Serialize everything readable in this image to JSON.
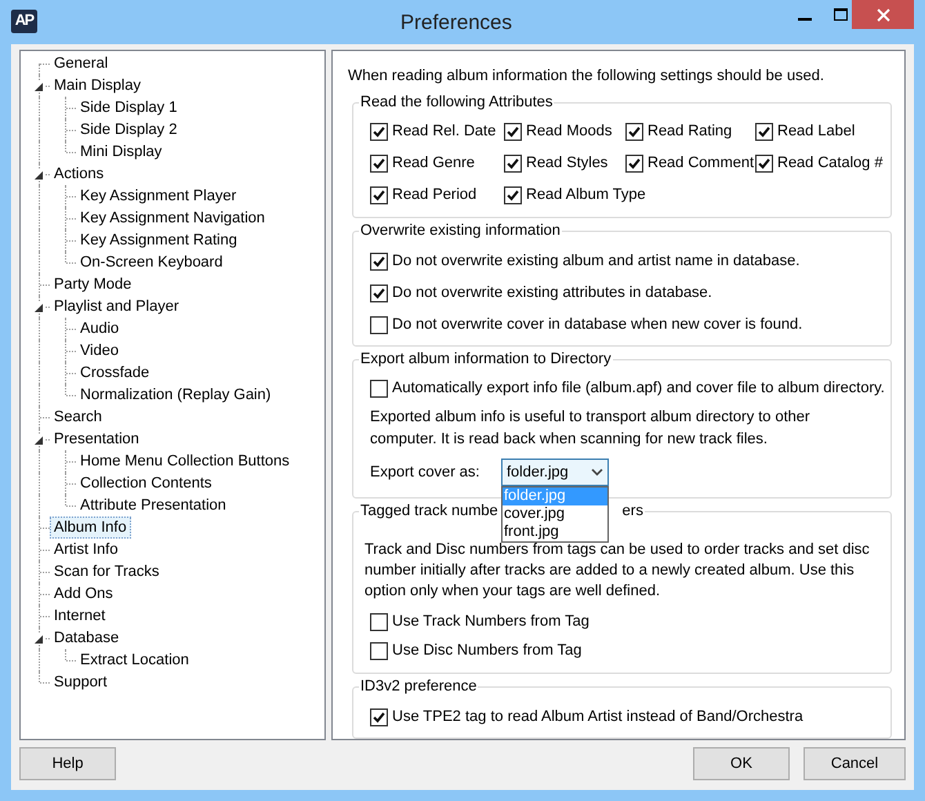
{
  "window": {
    "title": "Preferences",
    "logo": "AP"
  },
  "tree": [
    {
      "label": "General",
      "selected": false
    },
    {
      "label": "Main Display",
      "selected": false,
      "expanded": true,
      "children": [
        {
          "label": "Side Display 1",
          "selected": false
        },
        {
          "label": "Side Display 2",
          "selected": false
        },
        {
          "label": "Mini Display",
          "selected": false
        }
      ]
    },
    {
      "label": "Actions",
      "selected": false,
      "expanded": true,
      "children": [
        {
          "label": "Key Assignment Player",
          "selected": false
        },
        {
          "label": "Key Assignment Navigation",
          "selected": false
        },
        {
          "label": "Key Assignment Rating",
          "selected": false
        },
        {
          "label": "On-Screen Keyboard",
          "selected": false
        }
      ]
    },
    {
      "label": "Party Mode",
      "selected": false
    },
    {
      "label": "Playlist and Player",
      "selected": false,
      "expanded": true,
      "children": [
        {
          "label": "Audio",
          "selected": false
        },
        {
          "label": "Video",
          "selected": false
        },
        {
          "label": "Crossfade",
          "selected": false
        },
        {
          "label": "Normalization (Replay Gain)",
          "selected": false
        }
      ]
    },
    {
      "label": "Search",
      "selected": false
    },
    {
      "label": "Presentation",
      "selected": false,
      "expanded": true,
      "children": [
        {
          "label": "Home Menu Collection Buttons",
          "selected": false
        },
        {
          "label": "Collection Contents",
          "selected": false
        },
        {
          "label": "Attribute Presentation",
          "selected": false
        }
      ]
    },
    {
      "label": "Album Info",
      "selected": true
    },
    {
      "label": "Artist Info",
      "selected": false
    },
    {
      "label": "Scan for Tracks",
      "selected": false
    },
    {
      "label": "Add Ons",
      "selected": false
    },
    {
      "label": "Internet",
      "selected": false
    },
    {
      "label": "Database",
      "selected": false,
      "expanded": true,
      "children": [
        {
          "label": "Extract Location",
          "selected": false
        }
      ]
    },
    {
      "label": "Support",
      "selected": false
    }
  ],
  "intro": "When reading album information the following settings should be used.",
  "groups": [
    {
      "kind": "grid",
      "title": "Read the following Attributes",
      "items": [
        {
          "label": "Read Rel. Date",
          "checked": true
        },
        {
          "label": "Read Moods",
          "checked": true
        },
        {
          "label": "Read Rating",
          "checked": true
        },
        {
          "label": "Read Label",
          "checked": true
        },
        {
          "label": "Read Genre",
          "checked": true
        },
        {
          "label": "Read Styles",
          "checked": true
        },
        {
          "label": "Read Comment",
          "checked": true
        },
        {
          "label": "Read Catalog #",
          "checked": true
        },
        {
          "label": "Read Period",
          "checked": true
        },
        {
          "label": "Read Album Type",
          "checked": true
        }
      ]
    },
    {
      "kind": "list",
      "title": "Overwrite existing information",
      "items": [
        {
          "label": "Do not overwrite existing album and artist name in database.",
          "checked": true
        },
        {
          "label": "Do not overwrite existing attributes in database.",
          "checked": true
        },
        {
          "label": "Do not overwrite cover in database when new cover is found.",
          "checked": false
        }
      ]
    },
    {
      "kind": "export",
      "title": "Export album information to Directory",
      "items": [
        {
          "label": "Automatically export info file (album.apf) and cover file to album directory.",
          "checked": false
        }
      ],
      "text": "Exported album info is useful to transport album directory to other computer. It is read back when scanning for new track files.",
      "select_label": "Export cover as:",
      "value": "folder.jpg",
      "options": [
        {
          "label": "folder.jpg",
          "selected": true
        },
        {
          "label": "cover.jpg",
          "selected": false
        },
        {
          "label": "front.jpg",
          "selected": false
        }
      ]
    },
    {
      "kind": "tagged",
      "title_left": "Tagged track numbe",
      "title_right": "ers",
      "text": "Track and Disc numbers from tags can be used to order tracks and set disc number initially after tracks are added to a newly created album. Use this option only when your tags are well defined.",
      "items": [
        {
          "label": "Use Track Numbers from Tag",
          "checked": false
        },
        {
          "label": "Use Disc Numbers from Tag",
          "checked": false
        }
      ]
    },
    {
      "kind": "list",
      "title": "ID3v2 preference",
      "items": [
        {
          "label": "Use TPE2 tag to read Album Artist instead of Band/Orchestra",
          "checked": true
        }
      ]
    }
  ],
  "buttons": {
    "help": "Help",
    "ok": "OK",
    "cancel": "Cancel"
  }
}
